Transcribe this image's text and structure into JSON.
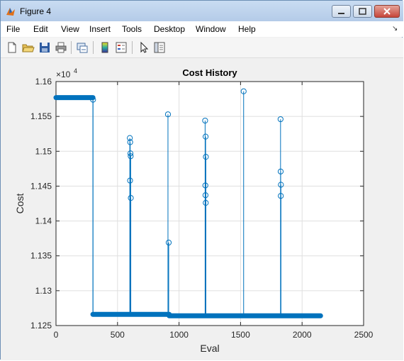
{
  "window": {
    "title": "Figure 4",
    "accent": "#c6453a"
  },
  "menubar": {
    "items": [
      "File",
      "Edit",
      "View",
      "Insert",
      "Tools",
      "Desktop",
      "Window",
      "Help"
    ]
  },
  "toolbar": {
    "icons": [
      "new-figure-icon",
      "open-folder-icon",
      "save-icon",
      "print-icon",
      "link-figure-icon",
      "colorbar-icon",
      "legend-icon",
      "pointer-icon",
      "property-editor-icon"
    ]
  },
  "chart_data": {
    "type": "line",
    "title": "Cost History",
    "xlabel": "Eval",
    "ylabel": "Cost",
    "exponent_label": "×10",
    "exponent_power": "4",
    "xlim": [
      0,
      2500
    ],
    "ylim": [
      11250,
      11600
    ],
    "x_ticks": [
      0,
      500,
      1000,
      1500,
      2000,
      2500
    ],
    "y_ticks": [
      11250,
      11300,
      11350,
      11400,
      11450,
      11500,
      11550,
      11600
    ],
    "x_tick_labels": [
      "0",
      "500",
      "1000",
      "1500",
      "2000",
      "2500"
    ],
    "y_tick_labels": [
      "1.125",
      "1.13",
      "1.135",
      "1.14",
      "1.145",
      "1.15",
      "1.155",
      "1.16"
    ],
    "grid": true,
    "series_color": "#0072bd",
    "baseline_segments": [
      {
        "x": [
          0,
          300
        ],
        "y": 11577
      },
      {
        "x": [
          300,
          920
        ],
        "y": 11266
      },
      {
        "x": [
          920,
          2150
        ],
        "y": 11264
      }
    ],
    "spikes": [
      {
        "x": 301,
        "y": 11574
      },
      {
        "x": 600,
        "y": 11519
      },
      {
        "x": 603,
        "y": 11513
      },
      {
        "x": 605,
        "y": 11497
      },
      {
        "x": 607,
        "y": 11493
      },
      {
        "x": 602,
        "y": 11458
      },
      {
        "x": 608,
        "y": 11433
      },
      {
        "x": 910,
        "y": 11553
      },
      {
        "x": 916,
        "y": 11369
      },
      {
        "x": 1212,
        "y": 11544
      },
      {
        "x": 1216,
        "y": 11521
      },
      {
        "x": 1218,
        "y": 11492
      },
      {
        "x": 1214,
        "y": 11451
      },
      {
        "x": 1215,
        "y": 11437
      },
      {
        "x": 1217,
        "y": 11426
      },
      {
        "x": 1525,
        "y": 11586
      },
      {
        "x": 1825,
        "y": 11546
      },
      {
        "x": 1826,
        "y": 11471
      },
      {
        "x": 1828,
        "y": 11452
      },
      {
        "x": 1827,
        "y": 11436
      }
    ]
  }
}
